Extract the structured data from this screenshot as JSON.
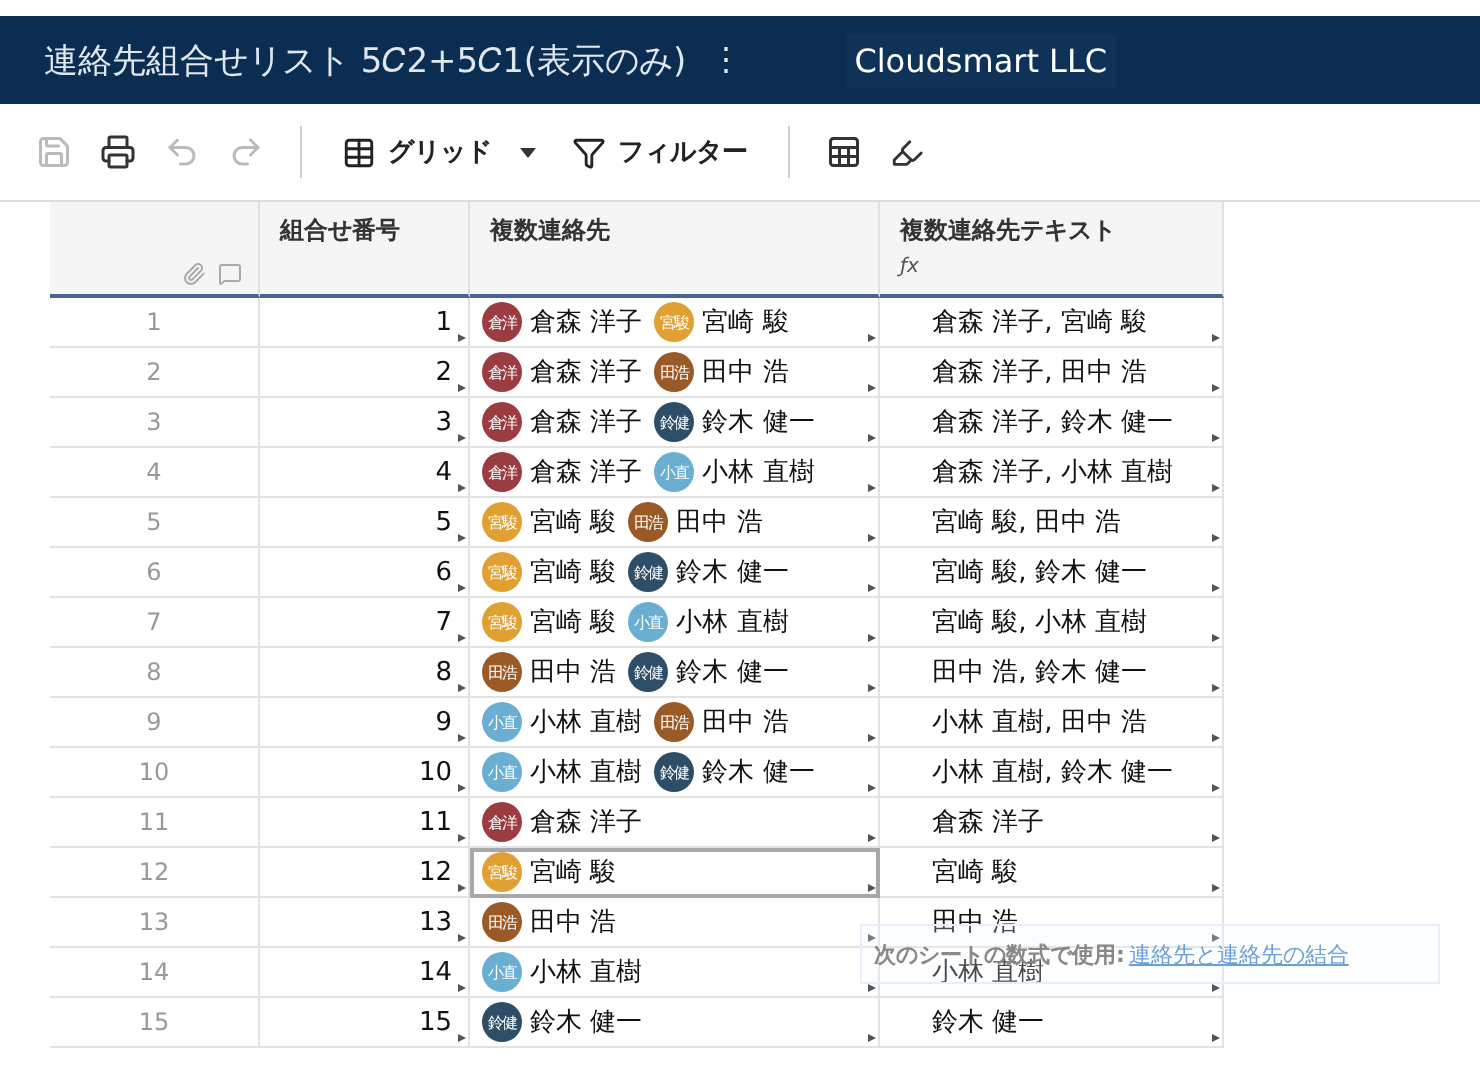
{
  "header": {
    "title": "連絡先組合せリスト 5𝐶2+5𝐶1(表示のみ)",
    "menu_glyph": "⋮",
    "workspace": "Cloudsmart LLC"
  },
  "toolbar": {
    "view_label": "グリッド",
    "filter_label": "フィルター"
  },
  "table": {
    "columns": [
      {
        "label": "組合せ番号"
      },
      {
        "label": "複数連絡先"
      },
      {
        "label": "複数連絡先テキスト",
        "formula_mark": "ƒx"
      }
    ],
    "rows": [
      {
        "number": "1",
        "index": "1",
        "contacts": [
          {
            "initials": "倉洋",
            "name": "倉森 洋子",
            "color": "#9b3c40"
          },
          {
            "initials": "宮駿",
            "name": "宮崎 駿",
            "color": "#e0a032"
          }
        ],
        "text": "倉森 洋子, 宮崎 駿",
        "selected": false
      },
      {
        "number": "2",
        "index": "2",
        "contacts": [
          {
            "initials": "倉洋",
            "name": "倉森 洋子",
            "color": "#9b3c40"
          },
          {
            "initials": "田浩",
            "name": "田中 浩",
            "color": "#9a5a26"
          }
        ],
        "text": "倉森 洋子, 田中 浩",
        "selected": false
      },
      {
        "number": "3",
        "index": "3",
        "contacts": [
          {
            "initials": "倉洋",
            "name": "倉森 洋子",
            "color": "#9b3c40"
          },
          {
            "initials": "鈴健",
            "name": "鈴木 健一",
            "color": "#2d4e66"
          }
        ],
        "text": "倉森 洋子, 鈴木 健一",
        "selected": false
      },
      {
        "number": "4",
        "index": "4",
        "contacts": [
          {
            "initials": "倉洋",
            "name": "倉森 洋子",
            "color": "#9b3c40"
          },
          {
            "initials": "小直",
            "name": "小林 直樹",
            "color": "#6aaed2"
          }
        ],
        "text": "倉森 洋子, 小林 直樹",
        "selected": false
      },
      {
        "number": "5",
        "index": "5",
        "contacts": [
          {
            "initials": "宮駿",
            "name": "宮崎 駿",
            "color": "#e0a032"
          },
          {
            "initials": "田浩",
            "name": "田中 浩",
            "color": "#9a5a26"
          }
        ],
        "text": "宮崎 駿, 田中 浩",
        "selected": false
      },
      {
        "number": "6",
        "index": "6",
        "contacts": [
          {
            "initials": "宮駿",
            "name": "宮崎 駿",
            "color": "#e0a032"
          },
          {
            "initials": "鈴健",
            "name": "鈴木 健一",
            "color": "#2d4e66"
          }
        ],
        "text": "宮崎 駿, 鈴木 健一",
        "selected": false
      },
      {
        "number": "7",
        "index": "7",
        "contacts": [
          {
            "initials": "宮駿",
            "name": "宮崎 駿",
            "color": "#e0a032"
          },
          {
            "initials": "小直",
            "name": "小林 直樹",
            "color": "#6aaed2"
          }
        ],
        "text": "宮崎 駿, 小林 直樹",
        "selected": false
      },
      {
        "number": "8",
        "index": "8",
        "contacts": [
          {
            "initials": "田浩",
            "name": "田中 浩",
            "color": "#9a5a26"
          },
          {
            "initials": "鈴健",
            "name": "鈴木 健一",
            "color": "#2d4e66"
          }
        ],
        "text": "田中 浩, 鈴木 健一",
        "selected": false
      },
      {
        "number": "9",
        "index": "9",
        "contacts": [
          {
            "initials": "小直",
            "name": "小林 直樹",
            "color": "#6aaed2"
          },
          {
            "initials": "田浩",
            "name": "田中 浩",
            "color": "#9a5a26"
          }
        ],
        "text": "小林 直樹, 田中 浩",
        "selected": false
      },
      {
        "number": "10",
        "index": "10",
        "contacts": [
          {
            "initials": "小直",
            "name": "小林 直樹",
            "color": "#6aaed2"
          },
          {
            "initials": "鈴健",
            "name": "鈴木 健一",
            "color": "#2d4e66"
          }
        ],
        "text": "小林 直樹, 鈴木 健一",
        "selected": false
      },
      {
        "number": "11",
        "index": "11",
        "contacts": [
          {
            "initials": "倉洋",
            "name": "倉森 洋子",
            "color": "#9b3c40"
          }
        ],
        "text": "倉森 洋子",
        "selected": false
      },
      {
        "number": "12",
        "index": "12",
        "contacts": [
          {
            "initials": "宮駿",
            "name": "宮崎 駿",
            "color": "#e0a032"
          }
        ],
        "text": "宮崎 駿",
        "selected": true
      },
      {
        "number": "13",
        "index": "13",
        "contacts": [
          {
            "initials": "田浩",
            "name": "田中 浩",
            "color": "#9a5a26"
          }
        ],
        "text": "田中 浩",
        "selected": false
      },
      {
        "number": "14",
        "index": "14",
        "contacts": [
          {
            "initials": "小直",
            "name": "小林 直樹",
            "color": "#6aaed2"
          }
        ],
        "text": "小林 直樹",
        "selected": false
      },
      {
        "number": "15",
        "index": "15",
        "contacts": [
          {
            "initials": "鈴健",
            "name": "鈴木 健一",
            "color": "#2d4e66"
          }
        ],
        "text": "鈴木 健一",
        "selected": false
      }
    ]
  },
  "tooltip": {
    "label": "次のシートの数式で使用:",
    "link": "連絡先と連絡先の結合"
  }
}
